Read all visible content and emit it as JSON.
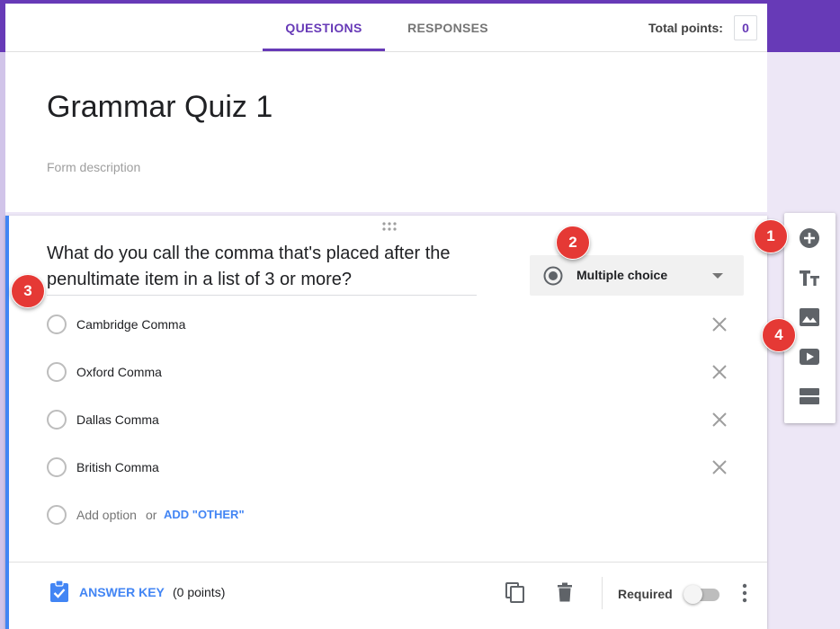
{
  "header": {
    "tabs": [
      {
        "label": "QUESTIONS",
        "active": true
      },
      {
        "label": "RESPONSES",
        "active": false
      }
    ],
    "total_points_label": "Total points:",
    "total_points_value": "0"
  },
  "form": {
    "title": "Grammar Quiz 1",
    "description_placeholder": "Form description"
  },
  "question": {
    "text": "What do you call the comma that's placed after the penultimate item in a list of 3 or more?",
    "type_label": "Multiple choice",
    "options": [
      {
        "label": "Cambridge Comma"
      },
      {
        "label": "Oxford Comma"
      },
      {
        "label": "Dallas Comma"
      },
      {
        "label": "British Comma"
      }
    ],
    "add_option_label": "Add option",
    "or_label": "or",
    "add_other_label": "ADD \"OTHER\""
  },
  "footer": {
    "answer_key_label": "ANSWER KEY",
    "points_note": "(0 points)",
    "required_label": "Required",
    "required_on": false
  },
  "toolbar": {
    "buttons": [
      "add-question",
      "add-title",
      "add-image",
      "add-video",
      "add-section"
    ]
  },
  "markers": [
    "1",
    "2",
    "3",
    "4"
  ],
  "colors": {
    "brand_purple": "#673ab7",
    "accent_blue": "#4285f4",
    "marker_red": "#e53935",
    "background_lavender": "#ede7f6"
  }
}
